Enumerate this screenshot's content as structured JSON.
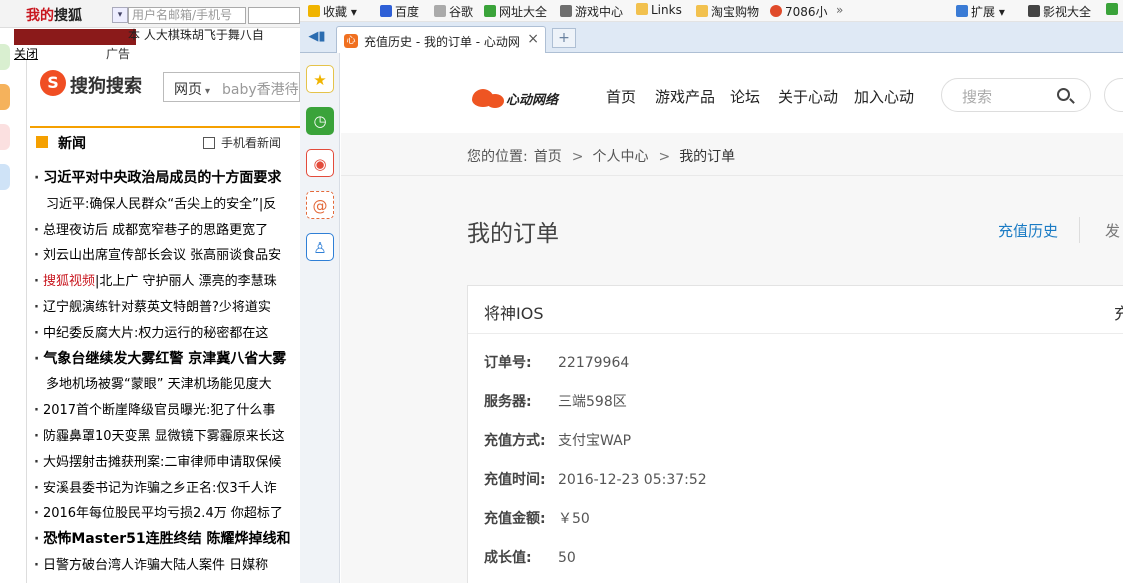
{
  "left_window": {
    "logo_prefix": "我的",
    "logo_suffix": "搜狐",
    "login_placeholder": "用户名邮箱/手机号",
    "ticker": "本 人大棋珠胡飞于舞八自",
    "close_label": "关闭",
    "ad_label": "广告",
    "sogou_label": "搜狗搜索",
    "sogou_category": "网页",
    "sogou_query": "baby香港待",
    "news_title": "新闻",
    "news_mobile": "手机看新闻",
    "news_items": [
      "习近平对中央政治局成员的十方面要求",
      "习近平:确保人民群众“舌尖上的安全”|反",
      "总理夜访后 成都宽窄巷子的思路更宽了",
      "刘云山出席宣传部长会议 张高丽谈食品安",
      "北上广 守护丽人 漂亮的李慧珠",
      "辽宁舰演练针对蔡英文特朗普?少将道实",
      "中纪委反腐大片:权力运行的秘密都在这",
      "气象台继续发大雾红警 京津冀八省大雾",
      "多地机场被雾“蒙眼” 天津机场能见度大",
      "2017首个断崖降级官员曝光:犯了什么事",
      "防霾鼻罩10天变黑 显微镜下雾霾原来长这",
      "大妈摆射击摊获刑案:二审律师申请取保候",
      "安溪县委书记为诈骗之乡正名:仅3千人诈",
      "2016年每位股民平均亏损2.4万 你超标了",
      "恐怖Master51连胜终结 陈耀烨掉线和",
      "日警方破台湾人诈骗大陆人案件 日媒称"
    ],
    "news_video_prefix": "搜狐视频"
  },
  "bookmarks": [
    {
      "label": "收藏",
      "icon": "star-icon",
      "color": "#f0b400"
    },
    {
      "label": "百度",
      "icon": "paw-icon",
      "color": "#2e5fd6"
    },
    {
      "label": "谷歌",
      "icon": "globe-icon",
      "color": "#888888"
    },
    {
      "label": "网址大全",
      "icon": "plus-icon",
      "color": "#3aa33a"
    },
    {
      "label": "游戏中心",
      "icon": "gamepad-icon",
      "color": "#6e6e6e"
    },
    {
      "label": "Links",
      "icon": "folder-icon",
      "color": "#f2c14e"
    },
    {
      "label": "淘宝购物",
      "icon": "folder-icon",
      "color": "#f2c14e"
    },
    {
      "label": "7086小",
      "icon": "balloon-icon",
      "color": "#e04a2a"
    }
  ],
  "bookmarks_more": "»",
  "toolbar_right": {
    "extensions_label": "扩展",
    "video_label": "影视大全"
  },
  "tab": {
    "title": "充值历史 - 我的订单 - 心动网",
    "close": "×",
    "new_tab": "+",
    "favicon_label": "心"
  },
  "site": {
    "logo_text": "心动网络",
    "nav": [
      "首页",
      "游戏产品",
      "论坛",
      "关于心动",
      "加入心动"
    ],
    "search_placeholder": "搜索"
  },
  "breadcrumb": {
    "prefix": "您的位置:",
    "items": [
      "首页",
      "个人中心",
      "我的订单"
    ],
    "separator": ">"
  },
  "page": {
    "title": "我的订单",
    "tab_active": "充值历史",
    "tab_next": "发"
  },
  "order": {
    "game": "将神IOS",
    "action_cut": "充",
    "fields": [
      {
        "label": "订单号:",
        "value": "22179964"
      },
      {
        "label": "服务器:",
        "value": "三端598区"
      },
      {
        "label": "充值方式:",
        "value": "支付宝WAP"
      },
      {
        "label": "充值时间:",
        "value": "2016-12-23 05:37:52"
      },
      {
        "label": "充值金额:",
        "value": "￥50"
      },
      {
        "label": "成长值:",
        "value": "50"
      }
    ]
  }
}
